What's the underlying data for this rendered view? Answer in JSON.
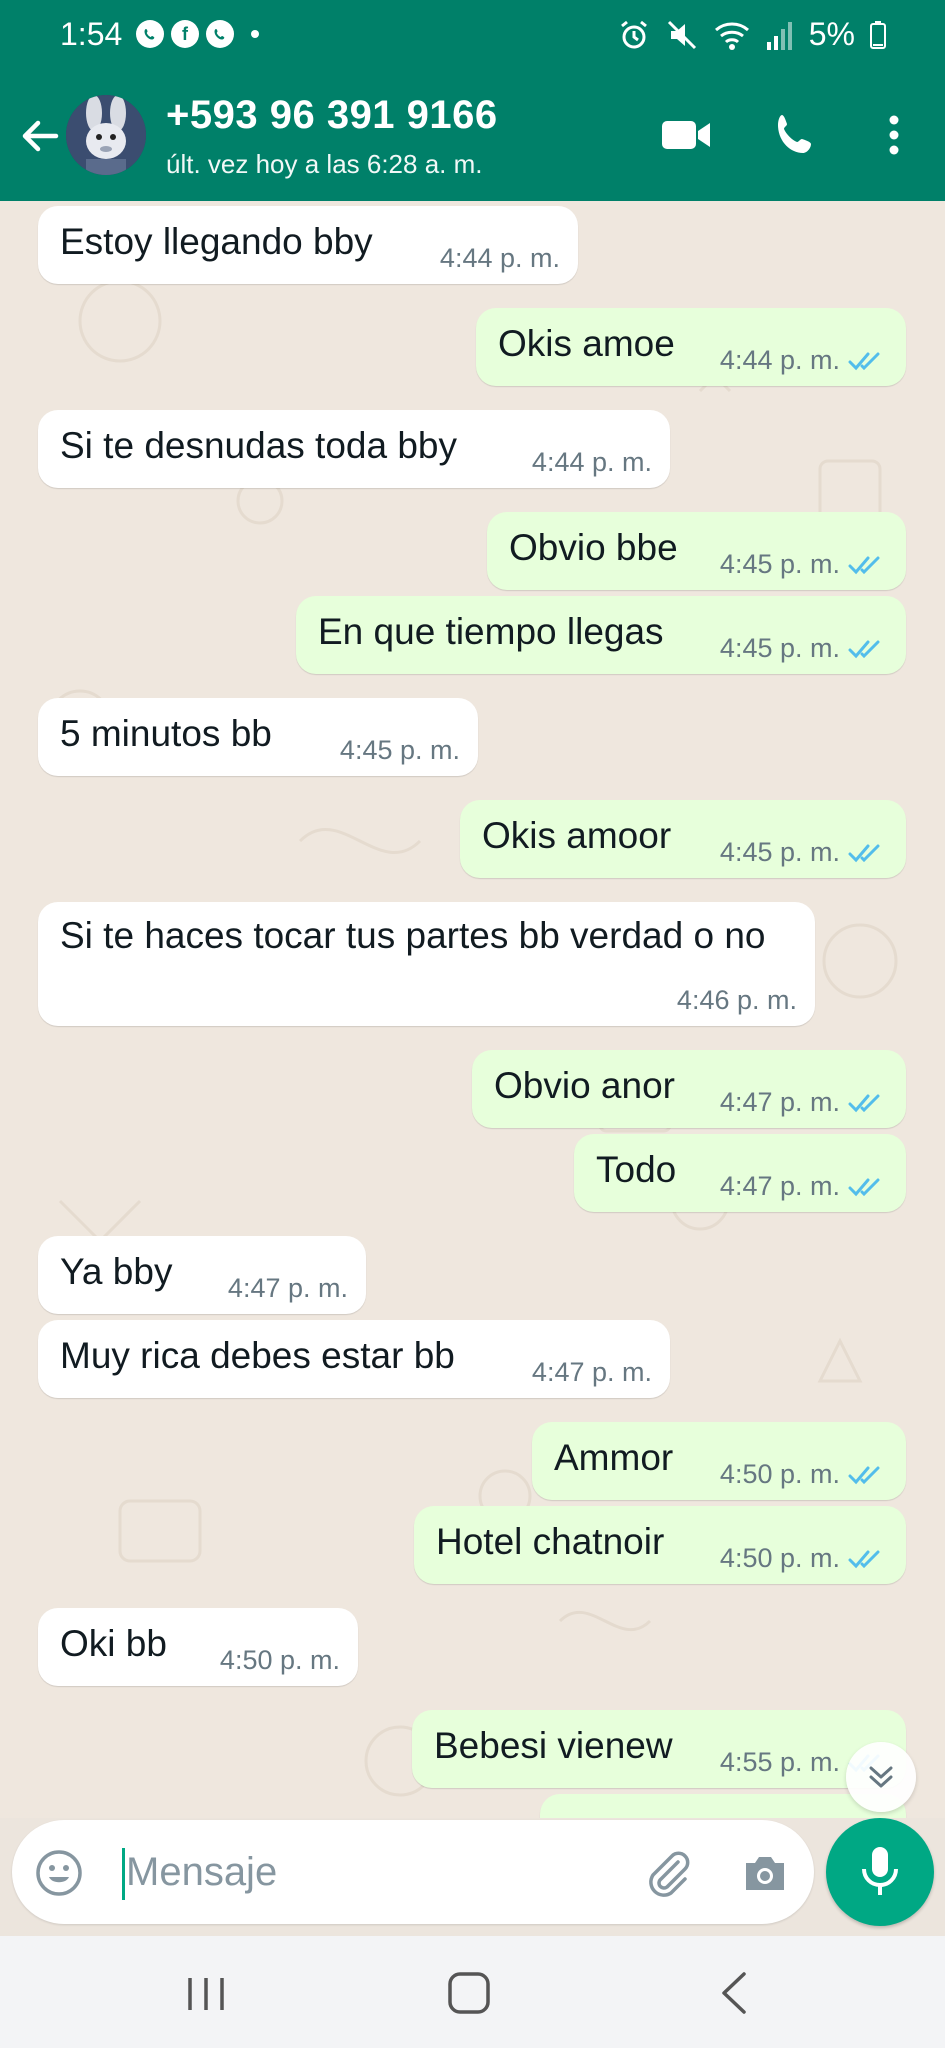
{
  "status_bar": {
    "time": "1:54",
    "battery": "5%",
    "notification_apps": [
      "whatsapp-icon",
      "facebook-icon",
      "whatsapp-icon"
    ]
  },
  "header": {
    "contact": "+593 96 391 9166",
    "last_seen": "últ. vez hoy a las 6:28 a. m.",
    "actions": [
      "video-call-icon",
      "voice-call-icon",
      "more-options-icon"
    ]
  },
  "colors": {
    "header_bg": "#008069",
    "outgoing_bubble": "#e7ffdb",
    "incoming_bubble": "#ffffff",
    "read_ticks": "#53bdeb",
    "accent": "#00a884"
  },
  "messages": [
    {
      "direction": "in",
      "text": "Estoy llegando bby",
      "time": "4:44 p. m."
    },
    {
      "direction": "out",
      "text": "Okis amoe",
      "time": "4:44 p. m.",
      "status": "read"
    },
    {
      "direction": "in",
      "text": "Si te desnudas toda bby",
      "time": "4:44 p. m."
    },
    {
      "direction": "out",
      "text": "Obvio bbe",
      "time": "4:45 p. m.",
      "status": "read"
    },
    {
      "direction": "out",
      "text": "En que tiempo llegas",
      "time": "4:45 p. m.",
      "status": "read"
    },
    {
      "direction": "in",
      "text": "5 minutos bb",
      "time": "4:45 p. m."
    },
    {
      "direction": "out",
      "text": "Okis amoor",
      "time": "4:45 p. m.",
      "status": "read"
    },
    {
      "direction": "in",
      "text": "Si te haces tocar tus partes bb verdad o no",
      "time": "4:46 p. m."
    },
    {
      "direction": "out",
      "text": "Obvio anor",
      "time": "4:47 p. m.",
      "status": "read"
    },
    {
      "direction": "out",
      "text": "Todo",
      "time": "4:47 p. m.",
      "status": "read"
    },
    {
      "direction": "in",
      "text": "Ya bby",
      "time": "4:47 p. m."
    },
    {
      "direction": "in",
      "text": "Muy rica debes estar bb",
      "time": "4:47 p. m."
    },
    {
      "direction": "out",
      "text": "Ammor",
      "time": "4:50 p. m.",
      "status": "read"
    },
    {
      "direction": "out",
      "text": "Hotel chatnoir",
      "time": "4:50 p. m.",
      "status": "read"
    },
    {
      "direction": "in",
      "text": "Oki bb",
      "time": "4:50 p. m."
    },
    {
      "direction": "out",
      "text": "Bebesi vienew",
      "time": "4:55 p. m.",
      "status": "read"
    }
  ],
  "composer": {
    "placeholder": "Mensaje",
    "value": ""
  },
  "nav": [
    "recent-apps-icon",
    "home-icon",
    "back-icon"
  ]
}
